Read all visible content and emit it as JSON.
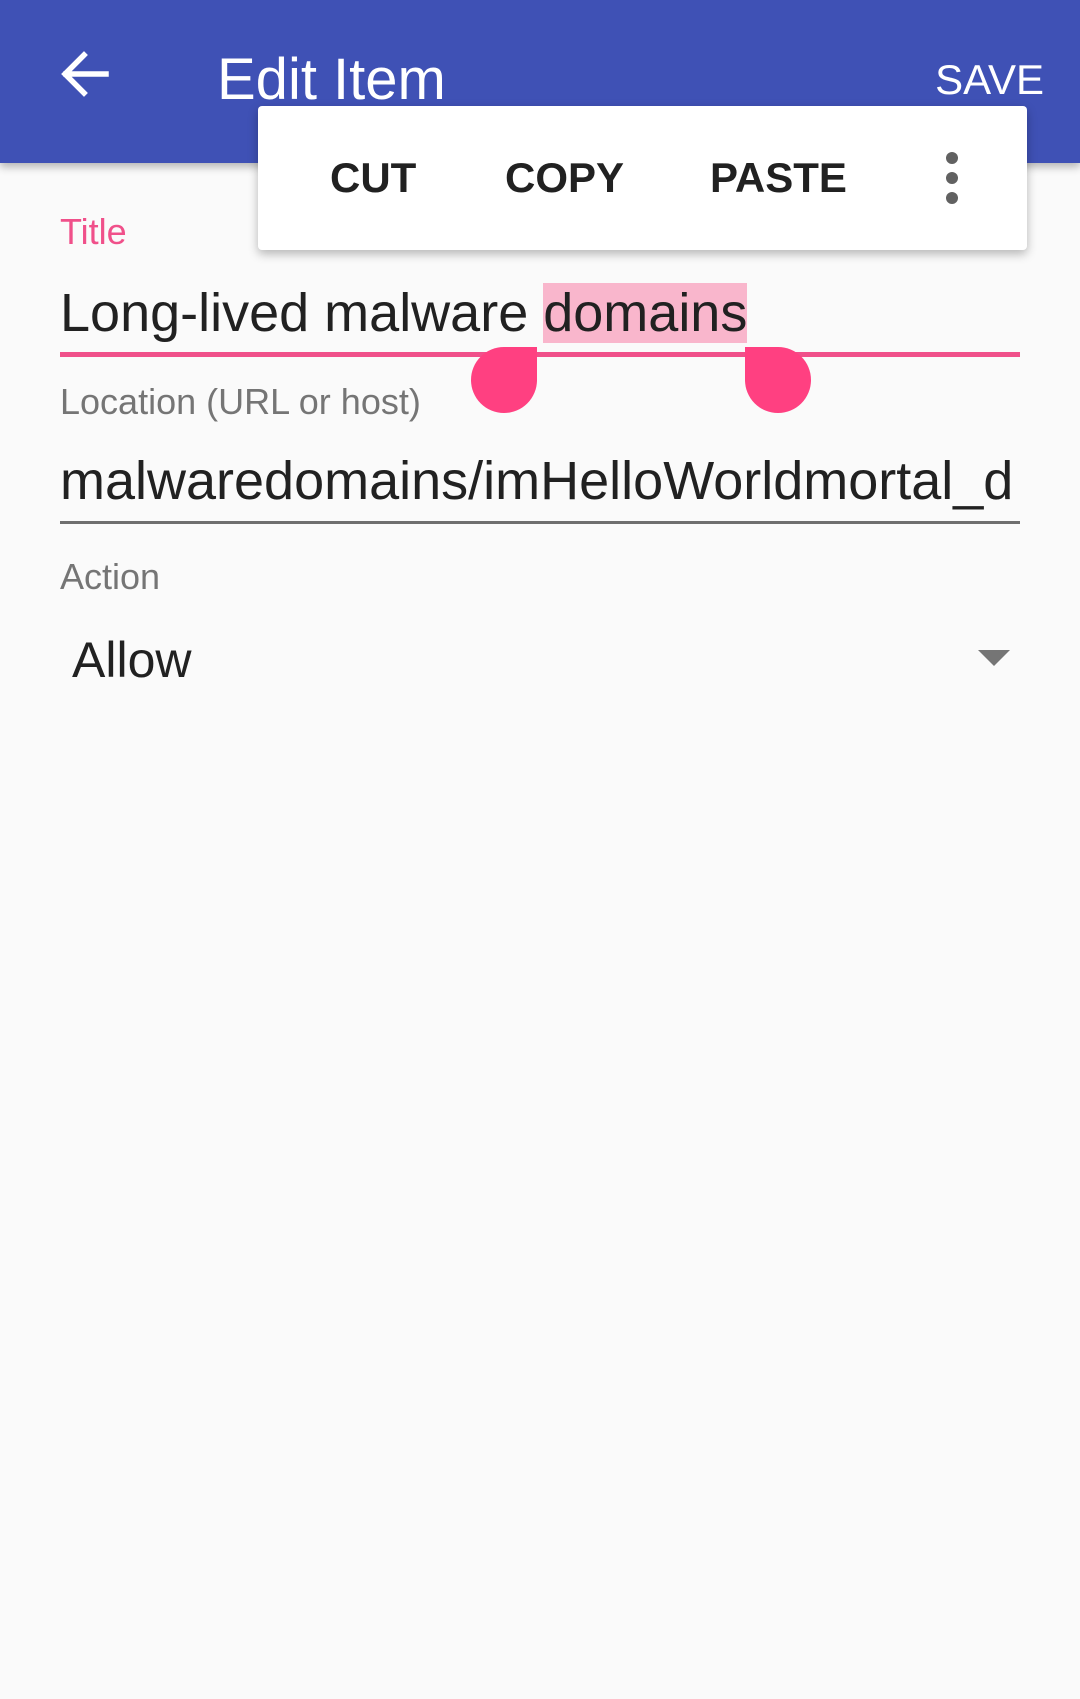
{
  "app_bar": {
    "title": "Edit Item",
    "save_label": "SAVE",
    "back_icon": "arrow-back-icon",
    "background_color": "#3f51b5"
  },
  "text_selection_menu": {
    "items": [
      "CUT",
      "COPY",
      "PASTE"
    ],
    "more_icon": "more-vert-icon"
  },
  "form": {
    "title_field": {
      "label": "Title",
      "value_before_selection": "Long-lived malware ",
      "selected_text": "domains",
      "accent_color": "#f0508a"
    },
    "location_field": {
      "label": "Location (URL or host)",
      "value": "malwaredomains/imHelloWorldmortal_d"
    },
    "action_field": {
      "label": "Action",
      "selected_value": "Allow",
      "dropdown_icon": "dropdown-arrow-icon"
    }
  }
}
